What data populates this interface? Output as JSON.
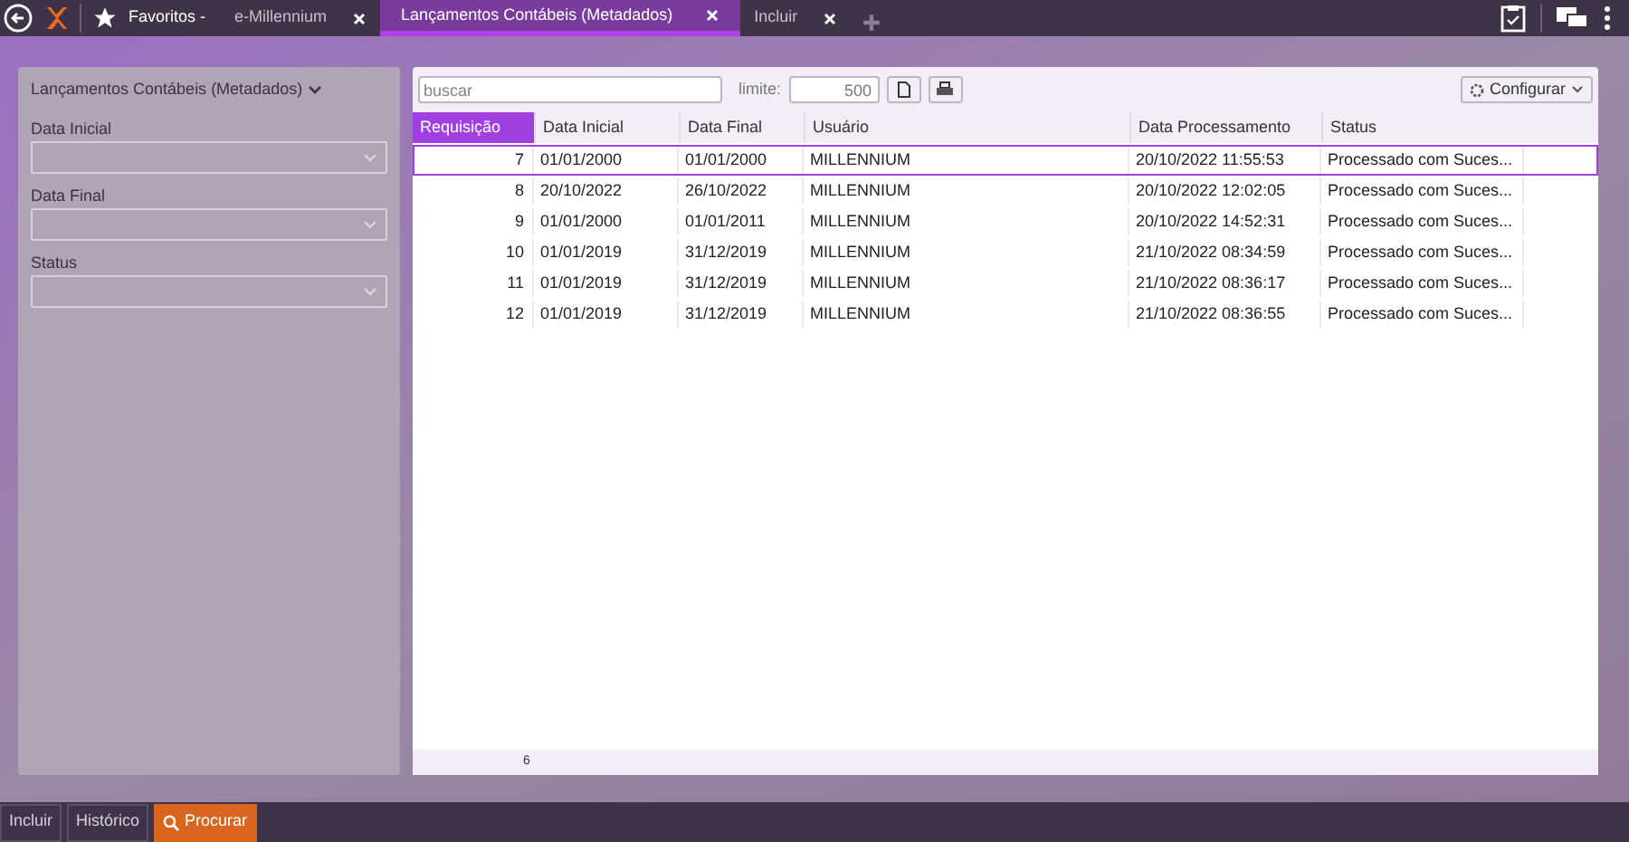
{
  "tabs": [
    {
      "label": "e-Millennium",
      "selected": false
    },
    {
      "label": "Lançamentos Contábeis (Metadados)",
      "selected": true
    },
    {
      "label": "Incluir",
      "selected": false
    }
  ],
  "favorites": "Favoritos -",
  "filter_panel": {
    "title": "Lançamentos Contábeis (Metadados)",
    "fields": [
      {
        "label": "Data Inicial"
      },
      {
        "label": "Data Final"
      },
      {
        "label": "Status"
      }
    ]
  },
  "toolbar": {
    "search": {
      "placeholder": "buscar"
    },
    "limit_label": "limite:",
    "limit": "500",
    "configure": "Configurar"
  },
  "table": {
    "columns": [
      {
        "label": "Requisição",
        "selected": true
      },
      {
        "label": "Data Inicial",
        "selected": false
      },
      {
        "label": "Data Final",
        "selected": false
      },
      {
        "label": "Usuário",
        "selected": false
      },
      {
        "label": "Data Processamento",
        "selected": false
      },
      {
        "label": "Status",
        "selected": false
      }
    ],
    "rows": [
      {
        "selected": true,
        "cells": [
          "7",
          "01/01/2000",
          "01/01/2000",
          "MILLENNIUM",
          "20/10/2022 11:55:53",
          "Processado com Suces..."
        ]
      },
      {
        "selected": false,
        "cells": [
          "8",
          "20/10/2022",
          "26/10/2022",
          "MILLENNIUM",
          "20/10/2022 12:02:05",
          "Processado com Suces..."
        ]
      },
      {
        "selected": false,
        "cells": [
          "9",
          "01/01/2000",
          "01/01/2011",
          "MILLENNIUM",
          "20/10/2022 14:52:31",
          "Processado com Suces..."
        ]
      },
      {
        "selected": false,
        "cells": [
          "10",
          "01/01/2019",
          "31/12/2019",
          "MILLENNIUM",
          "21/10/2022 08:34:59",
          "Processado com Suces..."
        ]
      },
      {
        "selected": false,
        "cells": [
          "11",
          "01/01/2019",
          "31/12/2019",
          "MILLENNIUM",
          "21/10/2022 08:36:17",
          "Processado com Suces..."
        ]
      },
      {
        "selected": false,
        "cells": [
          "12",
          "01/01/2019",
          "31/12/2019",
          "MILLENNIUM",
          "21/10/2022 08:36:55",
          "Processado com Suces..."
        ]
      }
    ],
    "count": "6"
  },
  "bottom_buttons": [
    {
      "label": "Incluir",
      "kind": "plain"
    },
    {
      "label": "Histórico",
      "kind": "plain"
    },
    {
      "label": "Procurar",
      "kind": "primary"
    }
  ]
}
